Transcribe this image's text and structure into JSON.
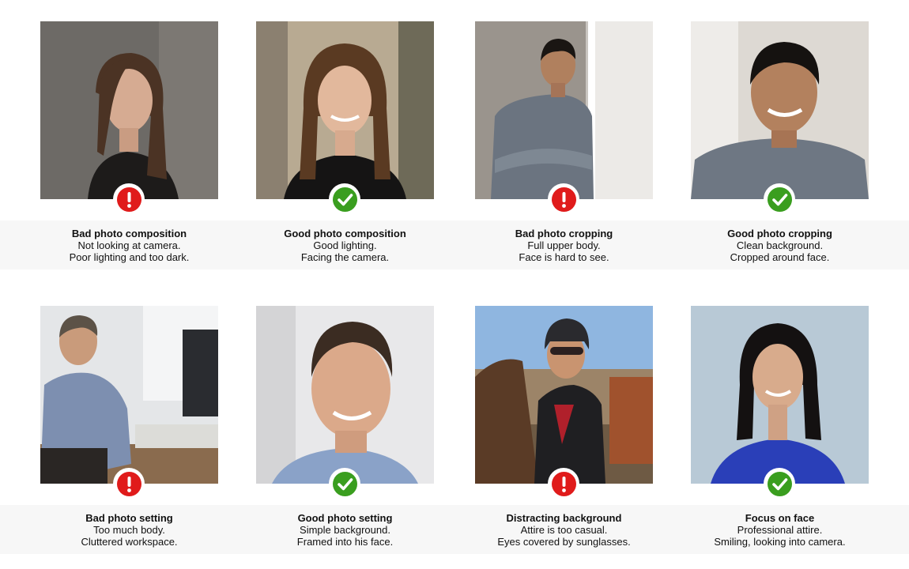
{
  "cards": [
    {
      "status": "bad",
      "status_icon": "exclamation-icon",
      "title": "Bad photo composition",
      "line1": "Not looking at camera.",
      "line2": "Poor lighting and too dark."
    },
    {
      "status": "good",
      "status_icon": "checkmark-icon",
      "title": "Good photo composition",
      "line1": "Good lighting.",
      "line2": "Facing the camera."
    },
    {
      "status": "bad",
      "status_icon": "exclamation-icon",
      "title": "Bad photo cropping",
      "line1": "Full upper body.",
      "line2": "Face is hard to see."
    },
    {
      "status": "good",
      "status_icon": "checkmark-icon",
      "title": "Good photo cropping",
      "line1": "Clean background.",
      "line2": "Cropped around face."
    },
    {
      "status": "bad",
      "status_icon": "exclamation-icon",
      "title": "Bad photo setting",
      "line1": "Too much body.",
      "line2": "Cluttered workspace."
    },
    {
      "status": "good",
      "status_icon": "checkmark-icon",
      "title": "Good photo setting",
      "line1": "Simple background.",
      "line2": "Framed into his face."
    },
    {
      "status": "bad",
      "status_icon": "exclamation-icon",
      "title": "Distracting background",
      "line1": "Attire is too casual.",
      "line2": "Eyes covered by sunglasses."
    },
    {
      "status": "good",
      "status_icon": "checkmark-icon",
      "title": "Focus on face",
      "line1": "Professional attire.",
      "line2": "Smiling, looking into camera."
    }
  ],
  "colors": {
    "bad": "#e01b1b",
    "good": "#3a9e1f",
    "band": "#f7f7f7"
  }
}
